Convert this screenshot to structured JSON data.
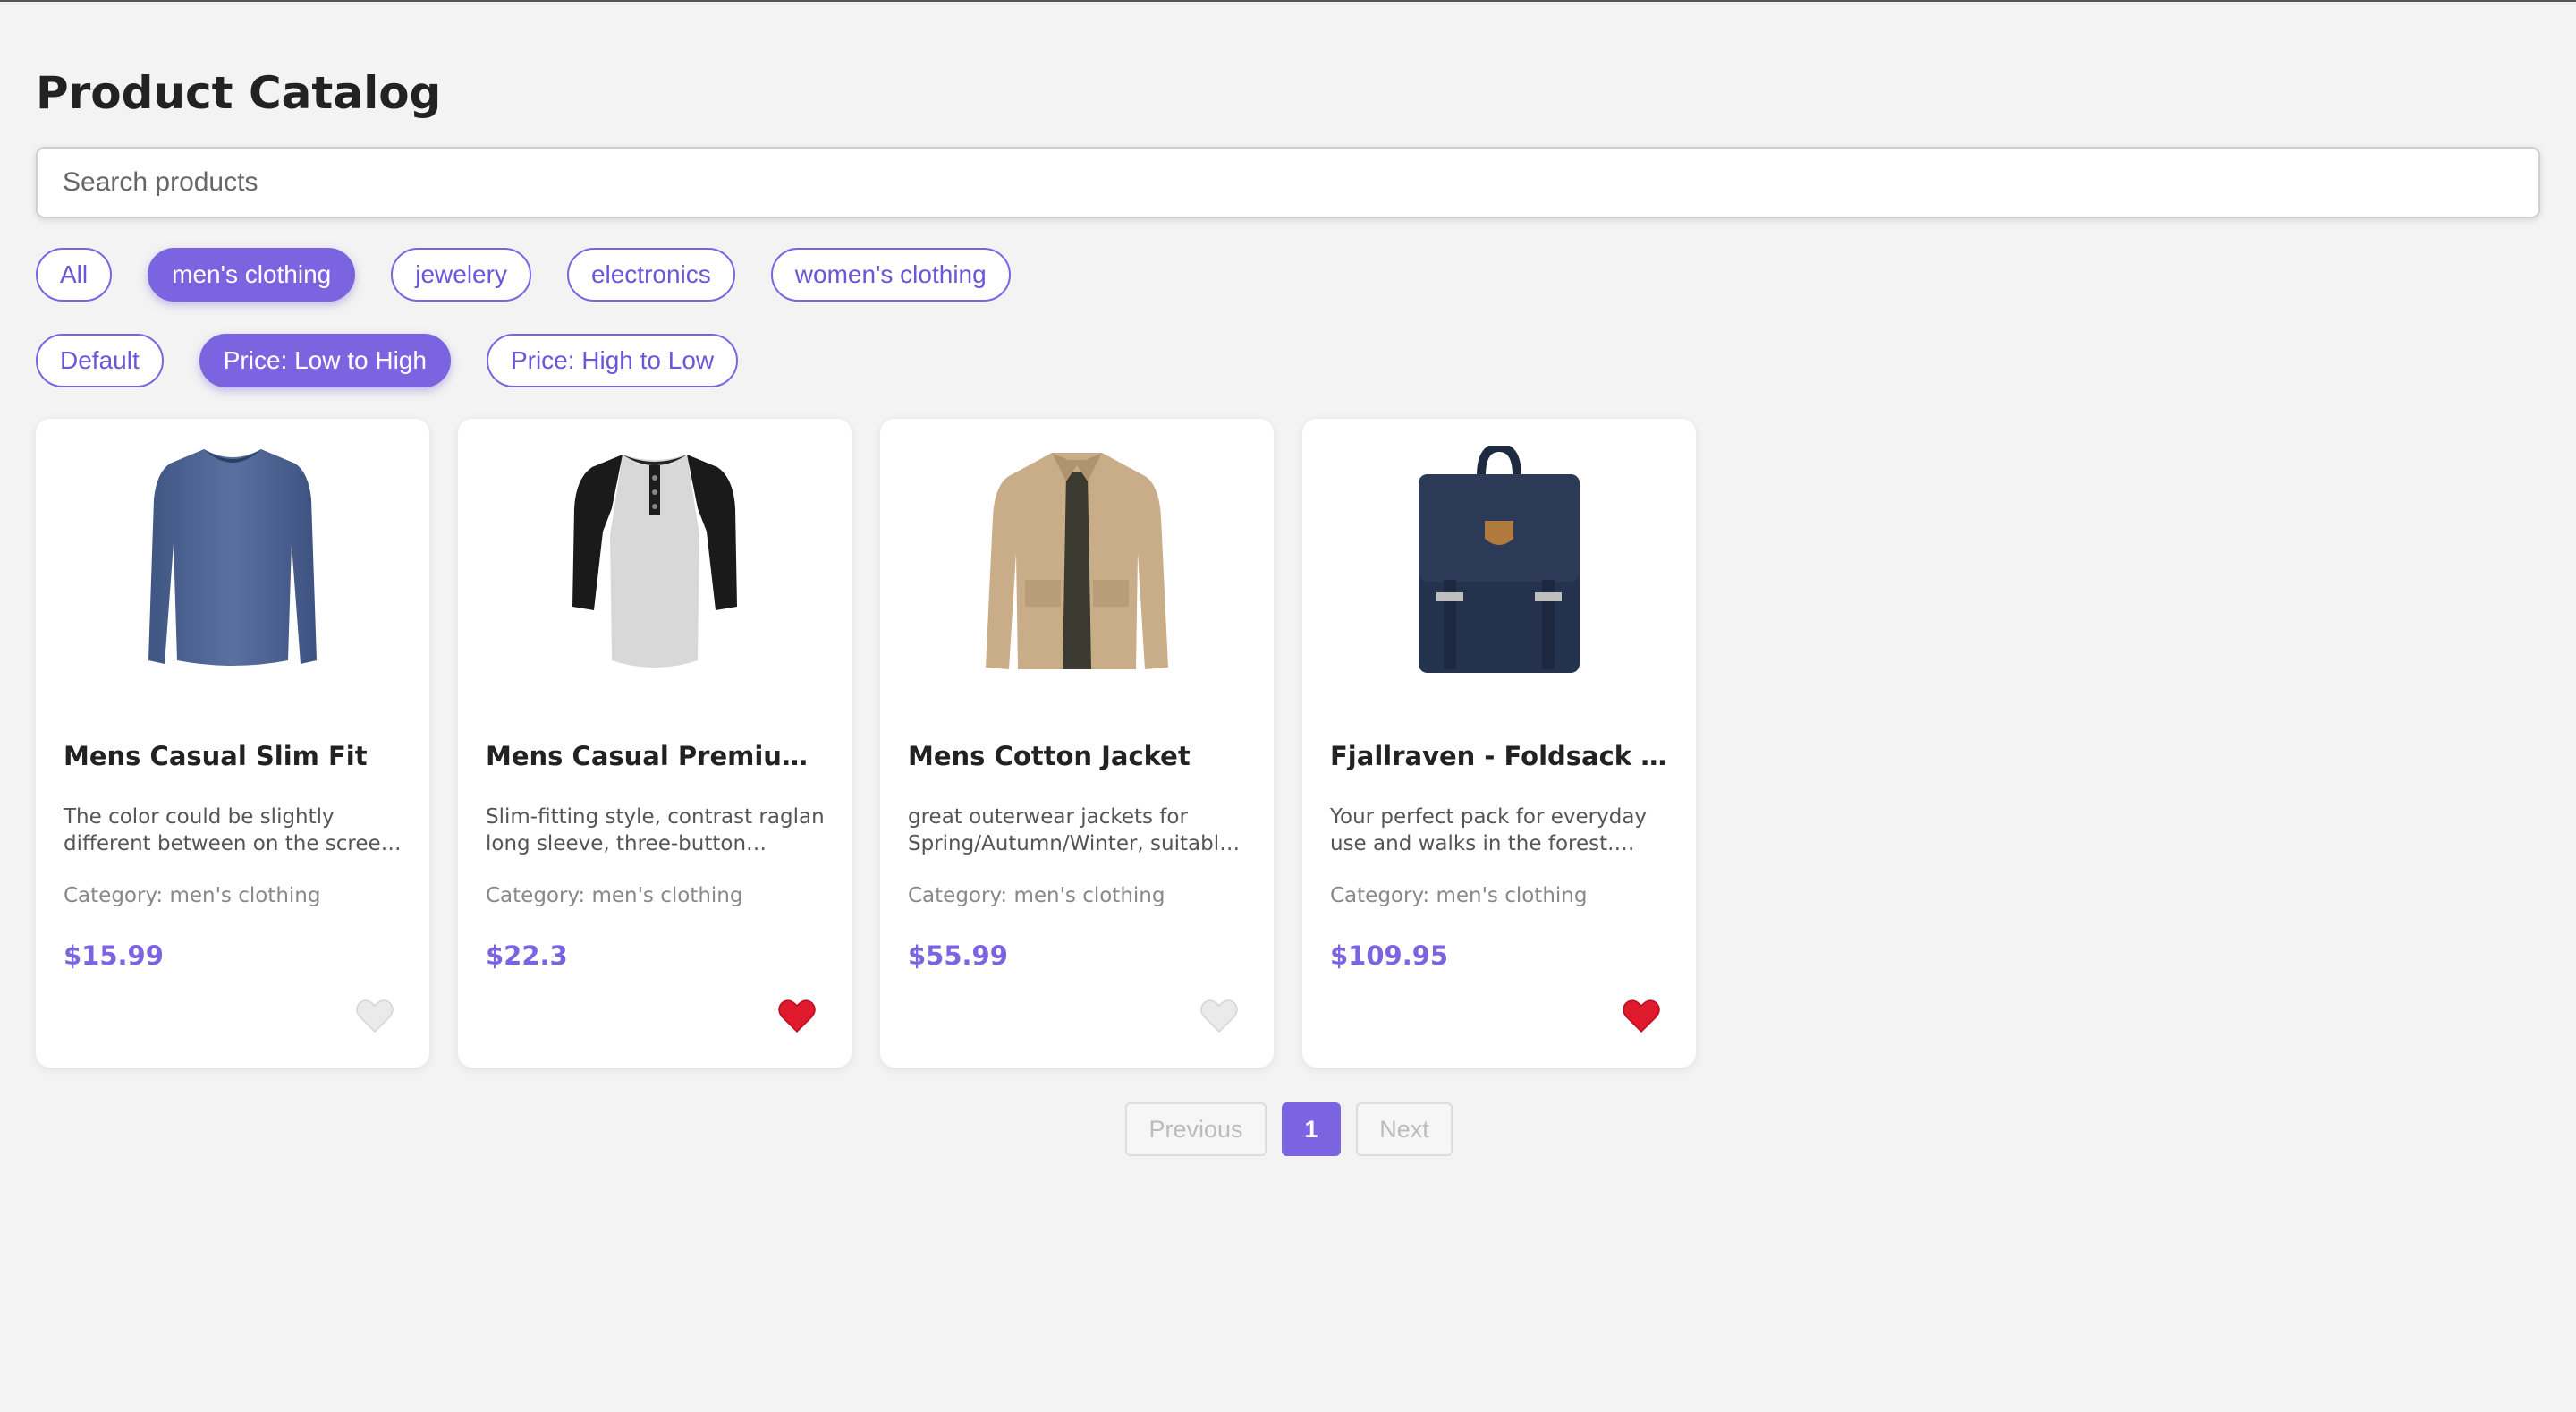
{
  "page": {
    "title": "Product Catalog"
  },
  "search": {
    "placeholder": "Search products",
    "value": ""
  },
  "categories": [
    {
      "label": "All",
      "active": false
    },
    {
      "label": "men's clothing",
      "active": true
    },
    {
      "label": "jewelery",
      "active": false
    },
    {
      "label": "electronics",
      "active": false
    },
    {
      "label": "women's clothing",
      "active": false
    }
  ],
  "sort_options": [
    {
      "label": "Default",
      "active": false
    },
    {
      "label": "Price: Low to High",
      "active": true
    },
    {
      "label": "Price: High to Low",
      "active": false
    }
  ],
  "products": [
    {
      "name": "Mens Casual Slim Fit",
      "description": "The color could be slightly different between on the screen and in…",
      "category": "Category: men's clothing",
      "price": "$15.99",
      "favorite": false,
      "image_icon": "blue-long-sleeve-shirt-icon"
    },
    {
      "name": "Mens Casual Premium Sl…",
      "description": "Slim-fitting style, contrast raglan long sleeve, three-button henley…",
      "category": "Category: men's clothing",
      "price": "$22.3",
      "favorite": true,
      "image_icon": "raglan-henley-shirt-icon"
    },
    {
      "name": "Mens Cotton Jacket",
      "description": "great outerwear jackets for Spring/Autumn/Winter, suitable f…",
      "category": "Category: men's clothing",
      "price": "$55.99",
      "favorite": false,
      "image_icon": "khaki-jacket-icon"
    },
    {
      "name": "Fjallraven - Foldsack No.…",
      "description": "Your perfect pack for everyday use and walks in the forest. Stash yo…",
      "category": "Category: men's clothing",
      "price": "$109.95",
      "favorite": true,
      "image_icon": "navy-backpack-icon"
    }
  ],
  "pagination": {
    "previous": "Previous",
    "current": "1",
    "next": "Next"
  },
  "colors": {
    "accent": "#7b64e0",
    "background": "#f3f3f3",
    "heart_active": "#e0192d",
    "heart_inactive": "#e6e6e6"
  }
}
